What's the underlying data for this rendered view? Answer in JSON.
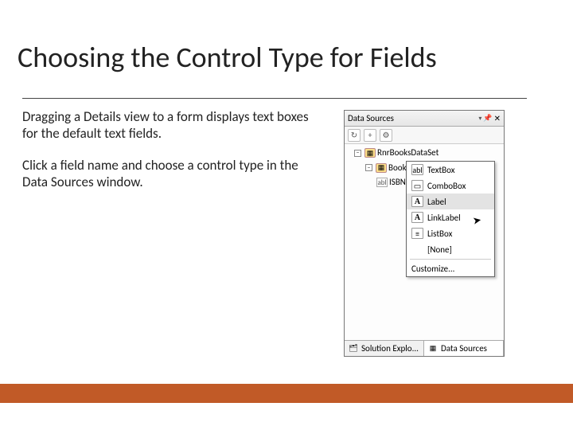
{
  "title": "Choosing the Control Type for Fields",
  "paragraphs": [
    "Dragging a Details view to a form displays text boxes for the default text fields.",
    "Click a field name and choose a control type in the Data Sources window."
  ],
  "panel": {
    "title": "Data Sources",
    "dataset": "RnrBooksDataSet",
    "table": "Books",
    "field": "ISBN"
  },
  "popup": {
    "items": [
      {
        "icon": "abl",
        "label": "TextBox"
      },
      {
        "icon": "▭",
        "label": "ComboBox"
      },
      {
        "icon": "A",
        "label": "Label",
        "highlight": true,
        "iconClass": "label"
      },
      {
        "icon": "A",
        "label": "LinkLabel",
        "iconClass": "label"
      },
      {
        "icon": "≡",
        "label": "ListBox"
      },
      {
        "icon": " ",
        "label": "[None]",
        "iconClass": "none"
      }
    ],
    "customize": "Customize..."
  },
  "tabs": {
    "solution": "Solution Explo...",
    "datasources": "Data Sources"
  }
}
